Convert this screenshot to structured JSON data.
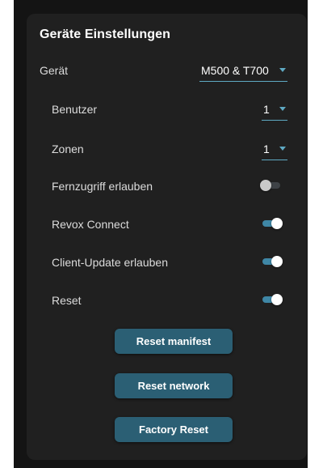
{
  "panel": {
    "title": "Geräte Einstellungen"
  },
  "device": {
    "label": "Gerät",
    "value": "M500 & T700"
  },
  "users": {
    "label": "Benutzer",
    "value": "1"
  },
  "zones": {
    "label": "Zonen",
    "value": "1"
  },
  "toggles": {
    "remote_access": {
      "label": "Fernzugriff erlauben",
      "on": false
    },
    "revox_connect": {
      "label": "Revox Connect",
      "on": true
    },
    "client_update": {
      "label": "Client-Update erlauben",
      "on": true
    },
    "reset": {
      "label": "Reset",
      "on": true
    }
  },
  "buttons": {
    "reset_manifest": "Reset manifest",
    "reset_network": "Reset network",
    "factory_reset": "Factory Reset"
  },
  "colors": {
    "accent": "#5fa9c3",
    "toggle_on": "#3f87a6",
    "button_bg": "#2b5f74",
    "panel_bg": "#202020"
  }
}
